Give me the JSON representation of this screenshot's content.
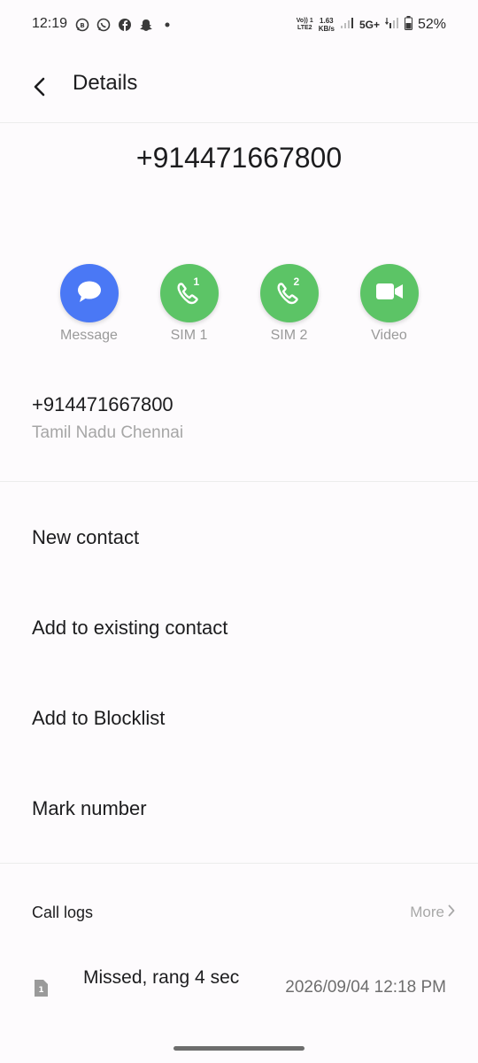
{
  "status_bar": {
    "time": "12:19",
    "volte_line1": "Vo)) 1",
    "volte_line2": "LTE2",
    "net_speed_value": "1.63",
    "net_speed_unit": "KB/s",
    "network": "5G+",
    "battery": "52%"
  },
  "header": {
    "title": "Details"
  },
  "contact": {
    "number_title": "+914471667800",
    "number": "+914471667800",
    "location": "Tamil Nadu Chennai"
  },
  "actions": [
    {
      "label": "Message",
      "icon": "message-icon",
      "color": "#4a78f5"
    },
    {
      "label": "SIM 1",
      "icon": "phone-sim1-icon",
      "badge": "1",
      "color": "#5cc466"
    },
    {
      "label": "SIM 2",
      "icon": "phone-sim2-icon",
      "badge": "2",
      "color": "#5cc466"
    },
    {
      "label": "Video",
      "icon": "video-icon",
      "color": "#5cc466"
    }
  ],
  "menu": {
    "new_contact": "New contact",
    "add_existing": "Add to existing contact",
    "add_blocklist": "Add to Blocklist",
    "mark_number": "Mark number"
  },
  "call_logs": {
    "title": "Call logs",
    "more": "More",
    "entries": [
      {
        "sim": "1",
        "status": "Missed, rang 4 sec",
        "datetime": "2026/09/04 12:18 PM"
      }
    ]
  }
}
